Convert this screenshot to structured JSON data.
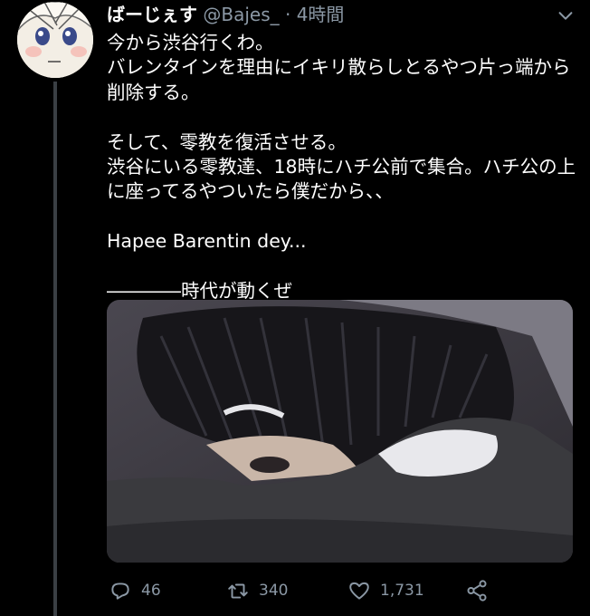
{
  "tweet": {
    "display_name": "ばーじぇす",
    "handle": "@Bajes_",
    "separator": "·",
    "time": "4時間",
    "text": "今から渋谷行くわ。\nバレンタインを理由にイキリ散らしとるやつ片っ端から\n削除する。\n\nそして、零教を復活させる。\n渋谷にいる零教達、18時にハチ公前で集合。ハチ公の上\nに座ってるやついたら僕だから、、\n\nHapee Barentin dey...\n\n――――時代が動くぜ",
    "has_media": true
  },
  "actions": {
    "reply_count": "46",
    "retweet_count": "340",
    "like_count": "1,731"
  },
  "icons": {
    "reply": "reply-icon",
    "retweet": "retweet-icon",
    "like": "heart-icon",
    "share": "share-icon",
    "more": "chevron-down-icon"
  },
  "colors": {
    "background": "#000000",
    "muted": "#8b98a5",
    "thread_line": "#3a3f44"
  }
}
